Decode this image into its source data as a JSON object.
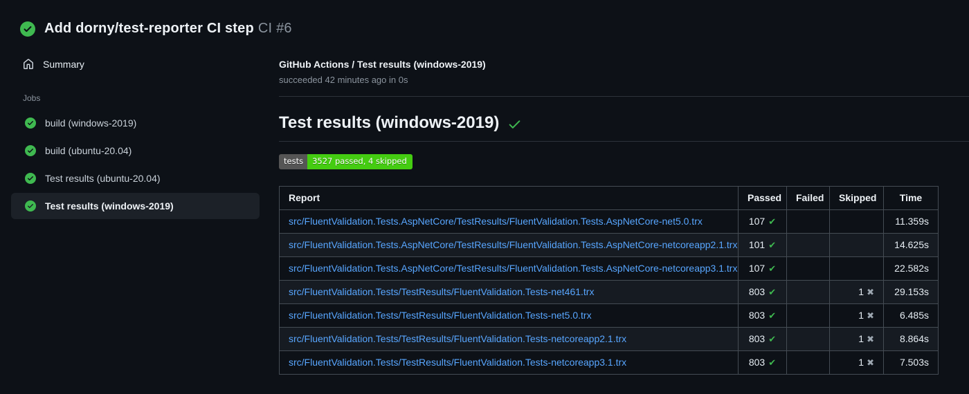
{
  "header": {
    "title": "Add dorny/test-reporter CI step",
    "run_number": "CI #6",
    "status": "success"
  },
  "sidebar": {
    "summary_label": "Summary",
    "jobs_label": "Jobs",
    "jobs": [
      {
        "label": "build (windows-2019)",
        "status": "success",
        "selected": false
      },
      {
        "label": "build (ubuntu-20.04)",
        "status": "success",
        "selected": false
      },
      {
        "label": "Test results (ubuntu-20.04)",
        "status": "success",
        "selected": false
      },
      {
        "label": "Test results (windows-2019)",
        "status": "success",
        "selected": true
      }
    ]
  },
  "main": {
    "run_title": "GitHub Actions / Test results (windows-2019)",
    "run_subtitle": "succeeded 42 minutes ago in 0s",
    "section_title": "Test results (windows-2019)",
    "badge": {
      "label": "tests",
      "value": "3527 passed, 4 skipped",
      "label_bg": "#555555",
      "value_bg": "#44cc11"
    },
    "table": {
      "columns": [
        "Report",
        "Passed",
        "Failed",
        "Skipped",
        "Time"
      ],
      "rows": [
        {
          "report": "src/FluentValidation.Tests.AspNetCore/TestResults/FluentValidation.Tests.AspNetCore-net5.0.trx",
          "passed": "107",
          "failed": "",
          "skipped": "",
          "time": "11.359s"
        },
        {
          "report": "src/FluentValidation.Tests.AspNetCore/TestResults/FluentValidation.Tests.AspNetCore-netcoreapp2.1.trx",
          "passed": "101",
          "failed": "",
          "skipped": "",
          "time": "14.625s"
        },
        {
          "report": "src/FluentValidation.Tests.AspNetCore/TestResults/FluentValidation.Tests.AspNetCore-netcoreapp3.1.trx",
          "passed": "107",
          "failed": "",
          "skipped": "",
          "time": "22.582s"
        },
        {
          "report": "src/FluentValidation.Tests/TestResults/FluentValidation.Tests-net461.trx",
          "passed": "803",
          "failed": "",
          "skipped": "1",
          "time": "29.153s"
        },
        {
          "report": "src/FluentValidation.Tests/TestResults/FluentValidation.Tests-net5.0.trx",
          "passed": "803",
          "failed": "",
          "skipped": "1",
          "time": "6.485s"
        },
        {
          "report": "src/FluentValidation.Tests/TestResults/FluentValidation.Tests-netcoreapp2.1.trx",
          "passed": "803",
          "failed": "",
          "skipped": "1",
          "time": "8.864s"
        },
        {
          "report": "src/FluentValidation.Tests/TestResults/FluentValidation.Tests-netcoreapp3.1.trx",
          "passed": "803",
          "failed": "",
          "skipped": "1",
          "time": "7.503s"
        }
      ]
    }
  },
  "colors": {
    "background": "#0d1117",
    "row_alt": "#161b22",
    "selected_item_bg": "#1c2128",
    "success_green": "#3fb950",
    "link_blue": "#58a6ff",
    "muted_text": "#8b949e",
    "table_border": "#454c54"
  },
  "icons": {
    "header_status": "check-circle-icon",
    "summary": "home-icon",
    "job_status": "check-circle-icon",
    "passed_mark": "check-icon",
    "skipped_mark": "x-icon"
  }
}
